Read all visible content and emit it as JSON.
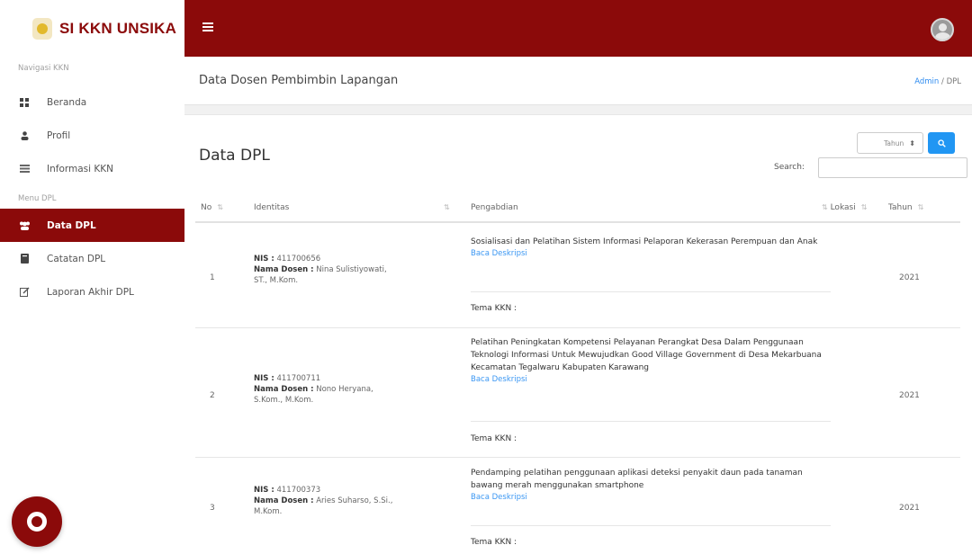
{
  "brand": {
    "title": "SI KKN UNSIKA"
  },
  "sidebar": {
    "heading_nav": "Navigasi KKN",
    "heading_menu": "Menu DPL",
    "items": [
      {
        "label": "Beranda",
        "icon": "dashboard-icon"
      },
      {
        "label": "Profil",
        "icon": "person-icon"
      },
      {
        "label": "Informasi KKN",
        "icon": "list-icon"
      },
      {
        "label": "Data DPL",
        "icon": "users-icon",
        "active": true
      },
      {
        "label": "Catatan DPL",
        "icon": "book-icon"
      },
      {
        "label": "Laporan Akhir DPL",
        "icon": "edit-icon"
      }
    ]
  },
  "header": {
    "title": "Data Dosen Pembimbin Lapangan",
    "breadcrumb": {
      "link": "Admin",
      "separator": "/",
      "current": "DPL"
    }
  },
  "card": {
    "title": "Data DPL",
    "year_select": "Tahun",
    "search_label": "Search:",
    "search_value": ""
  },
  "table": {
    "columns": [
      "No",
      "Identitas",
      "Pengabdian",
      "Lokasi",
      "Tahun"
    ],
    "nis_label": "NIS :",
    "dosen_label": "Nama Dosen :",
    "baca_label": "Baca Deskripsi",
    "tema_label": "Tema KKN :",
    "rows": [
      {
        "no": "1",
        "nis": "411700656",
        "dosen": "Nina Sulistiyowati, ST., M.Kom.",
        "pengabdian": "Sosialisasi dan Pelatihan Sistem Informasi Pelaporan Kekerasan Perempuan dan Anak",
        "tahun": "2021"
      },
      {
        "no": "2",
        "nis": "411700711",
        "dosen": "Nono Heryana, S.Kom., M.Kom.",
        "pengabdian": "Pelatihan Peningkatan Kompetensi Pelayanan Perangkat Desa Dalam Penggunaan Teknologi Informasi Untuk Mewujudkan Good Village Government di Desa Mekarbuana Kecamatan Tegalwaru Kabupaten Karawang",
        "tahun": "2021"
      },
      {
        "no": "3",
        "nis": "411700373",
        "dosen": "Aries Suharso, S.Si., M.Kom.",
        "pengabdian": "Pendamping pelatihan penggunaan aplikasi deteksi penyakit daun pada tanaman bawang merah menggunakan smartphone",
        "tahun": "2021"
      }
    ]
  },
  "colors": {
    "brand": "#8b0a0a",
    "link": "#2f8cf0",
    "button": "#2196f3"
  }
}
